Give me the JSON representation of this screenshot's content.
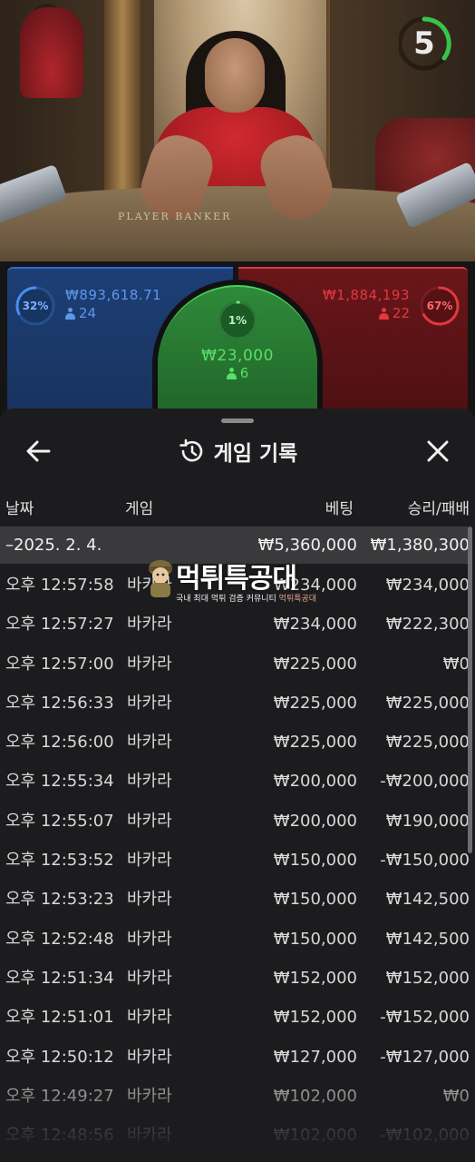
{
  "video": {
    "table_text": "PLAYER   BANKER",
    "countdown": "5"
  },
  "betting": {
    "player": {
      "percent": "32%",
      "percent_value": 0.32,
      "amount": "₩893,618.71",
      "players": "24",
      "color": "#2f6bd0"
    },
    "tie": {
      "percent": "1%",
      "percent_value": 0.01,
      "amount": "₩23,000",
      "players": "6",
      "color": "#4ad05a"
    },
    "banker": {
      "percent": "67%",
      "percent_value": 0.67,
      "amount": "₩1,884,193",
      "players": "22",
      "color": "#e0393e"
    }
  },
  "modal": {
    "title": "게임 기록",
    "columns": {
      "date": "날짜",
      "game": "게임",
      "bet": "베팅",
      "result": "승리/패배"
    },
    "summary": {
      "date": "–2025. 2. 4.",
      "bet": "₩5,360,000",
      "result": "₩1,380,300"
    },
    "rows": [
      {
        "time": "오후 12:57:58",
        "game": "바카라",
        "bet": "₩234,000",
        "result": "₩234,000"
      },
      {
        "time": "오후 12:57:27",
        "game": "바카라",
        "bet": "₩234,000",
        "result": "₩222,300"
      },
      {
        "time": "오후 12:57:00",
        "game": "바카라",
        "bet": "₩225,000",
        "result": "₩0"
      },
      {
        "time": "오후 12:56:33",
        "game": "바카라",
        "bet": "₩225,000",
        "result": "₩225,000"
      },
      {
        "time": "오후 12:56:00",
        "game": "바카라",
        "bet": "₩225,000",
        "result": "₩225,000"
      },
      {
        "time": "오후 12:55:34",
        "game": "바카라",
        "bet": "₩200,000",
        "result": "-₩200,000"
      },
      {
        "time": "오후 12:55:07",
        "game": "바카라",
        "bet": "₩200,000",
        "result": "₩190,000"
      },
      {
        "time": "오후 12:53:52",
        "game": "바카라",
        "bet": "₩150,000",
        "result": "-₩150,000"
      },
      {
        "time": "오후 12:53:23",
        "game": "바카라",
        "bet": "₩150,000",
        "result": "₩142,500"
      },
      {
        "time": "오후 12:52:48",
        "game": "바카라",
        "bet": "₩150,000",
        "result": "₩142,500"
      },
      {
        "time": "오후 12:51:34",
        "game": "바카라",
        "bet": "₩152,000",
        "result": "₩152,000"
      },
      {
        "time": "오후 12:51:01",
        "game": "바카라",
        "bet": "₩152,000",
        "result": "-₩152,000"
      },
      {
        "time": "오후 12:50:12",
        "game": "바카라",
        "bet": "₩127,000",
        "result": "-₩127,000"
      },
      {
        "time": "오후 12:49:27",
        "game": "바카라",
        "bet": "₩102,000",
        "result": "₩0"
      },
      {
        "time": "오후 12:48:56",
        "game": "바카라",
        "bet": "₩102,000",
        "result": "-₩102,000"
      }
    ]
  },
  "watermark": {
    "title": "먹튀특공대",
    "subtitle": "국내 최대 먹튀 검증 커뮤니티 ",
    "subtitle_accent": "먹튀특공대"
  }
}
